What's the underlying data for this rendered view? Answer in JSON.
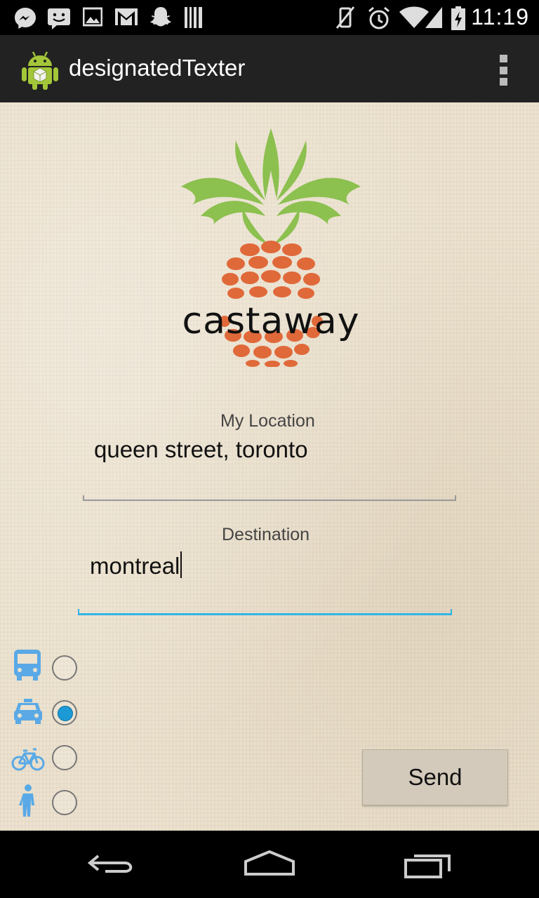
{
  "status_bar": {
    "time": "11:19",
    "left_icons": [
      "messenger-icon",
      "chat-icon",
      "image-icon",
      "gmail-icon",
      "snapchat-icon",
      "barcode-icon"
    ],
    "right_icons": [
      "vibrate-off-icon",
      "alarm-icon",
      "wifi-icon",
      "signal-icon",
      "battery-charging-icon"
    ]
  },
  "action_bar": {
    "title": "designatedTexter"
  },
  "logo": {
    "text": "castaway"
  },
  "form": {
    "location_label": "My Location",
    "location_value": "queen street, toronto",
    "destination_label": "Destination",
    "destination_value": "montreal"
  },
  "transport_modes": [
    {
      "icon": "bus-icon",
      "checked": false
    },
    {
      "icon": "taxi-icon",
      "checked": true
    },
    {
      "icon": "bicycle-icon",
      "checked": false
    },
    {
      "icon": "walk-icon",
      "checked": false
    }
  ],
  "send_label": "Send",
  "colors": {
    "accent": "#33b5e5",
    "radio_selected": "#1b9ad6",
    "icon_blue": "#5aa9e6",
    "pineapple_leaves": "#8cc04f",
    "pineapple_body": "#e0693a"
  }
}
